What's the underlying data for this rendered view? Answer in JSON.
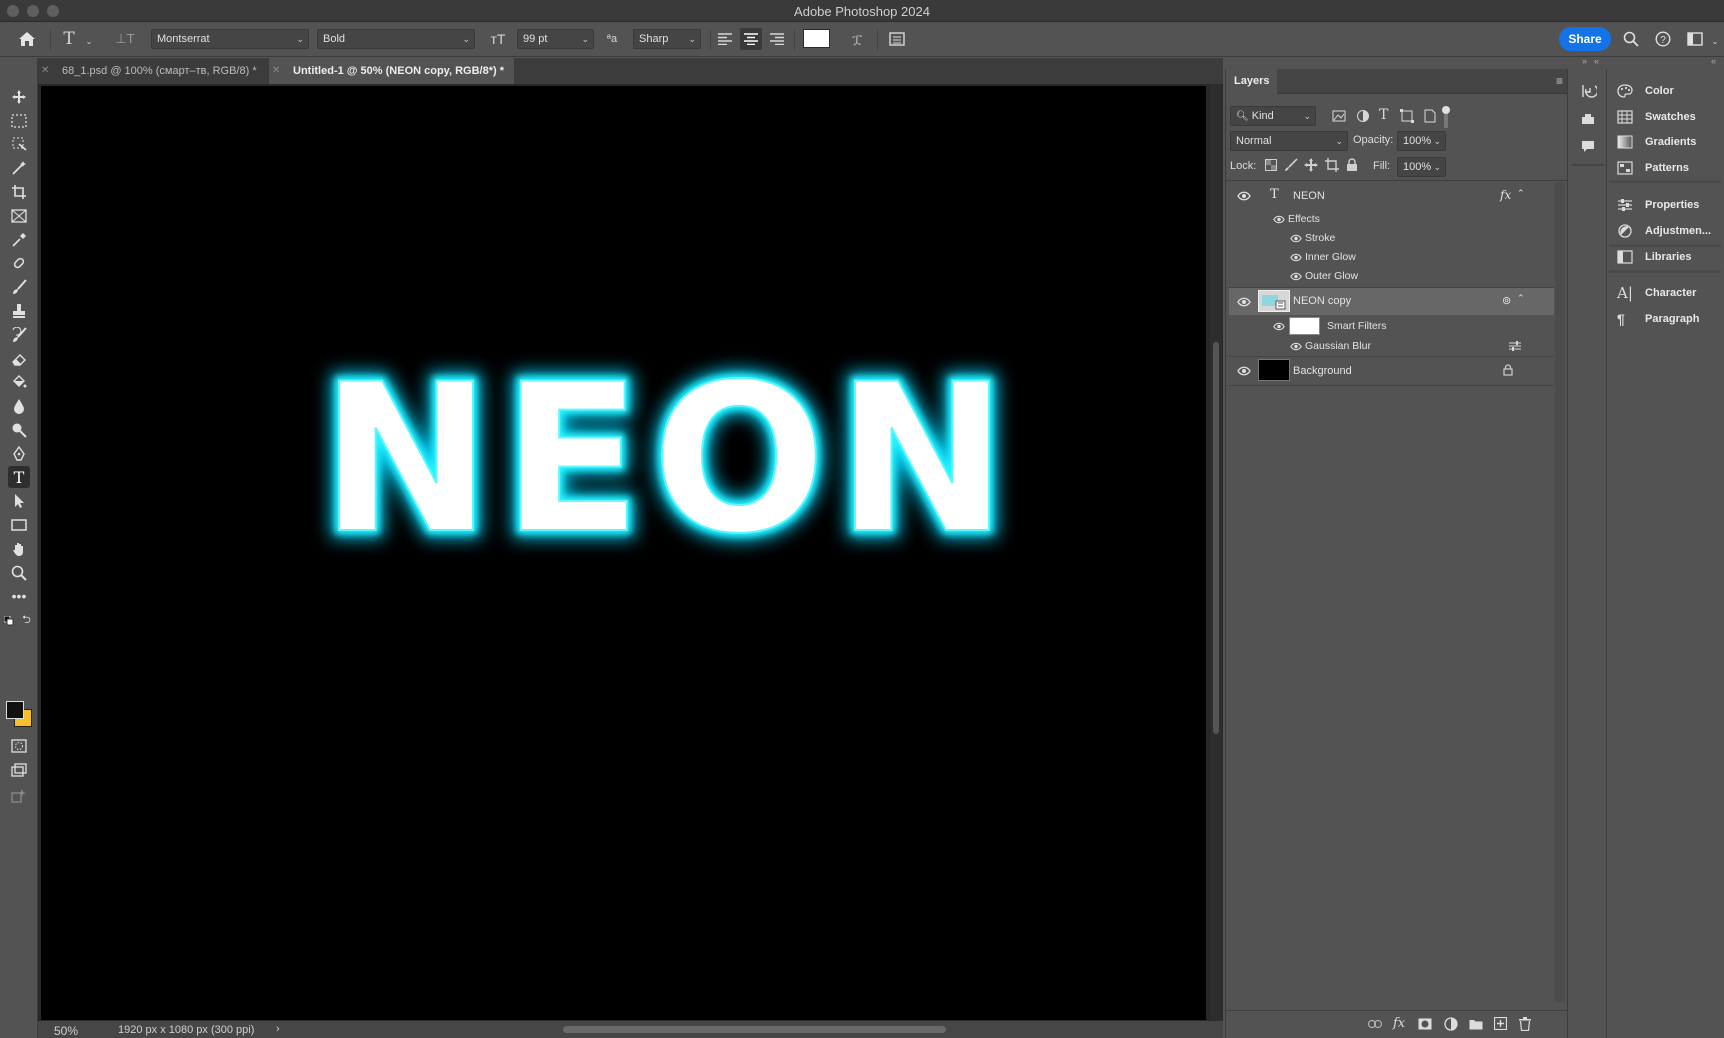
{
  "app": {
    "title": "Adobe Photoshop 2024"
  },
  "options_bar": {
    "font_family": "Montserrat",
    "font_style": "Bold",
    "font_size": "99 pt",
    "antialias": "Sharp",
    "text_color": "#ffffff",
    "share_label": "Share"
  },
  "tabs": [
    {
      "label": "68_1.psd @ 100% (смарт–тв, RGB/8) *",
      "active": false
    },
    {
      "label": "Untitled-1 @ 50% (NEON copy, RGB/8*) *",
      "active": true
    }
  ],
  "canvas": {
    "text": "NEON",
    "glow_color": "#00e5ff"
  },
  "status": {
    "zoom": "50%",
    "doc_info": "1920 px x 1080 px (300 ppi)"
  },
  "layers_panel": {
    "title": "Layers",
    "filter_kind": "Kind",
    "blend_mode": "Normal",
    "opacity_label": "Opacity:",
    "opacity_value": "100%",
    "lock_label": "Lock:",
    "fill_label": "Fill:",
    "fill_value": "100%",
    "layers": [
      {
        "name": "NEON",
        "effects_label": "Effects",
        "effects": [
          "Stroke",
          "Inner Glow",
          "Outer Glow"
        ]
      },
      {
        "name": "NEON copy",
        "smart_filters_label": "Smart Filters",
        "filters": [
          "Gaussian Blur"
        ]
      },
      {
        "name": "Background"
      }
    ]
  },
  "right_panel": {
    "group1": [
      "Color",
      "Swatches",
      "Gradients",
      "Patterns"
    ],
    "group2": [
      "Properties",
      "Adjustmen..."
    ],
    "group3": [
      "Libraries"
    ],
    "group4": [
      "Character",
      "Paragraph"
    ]
  }
}
